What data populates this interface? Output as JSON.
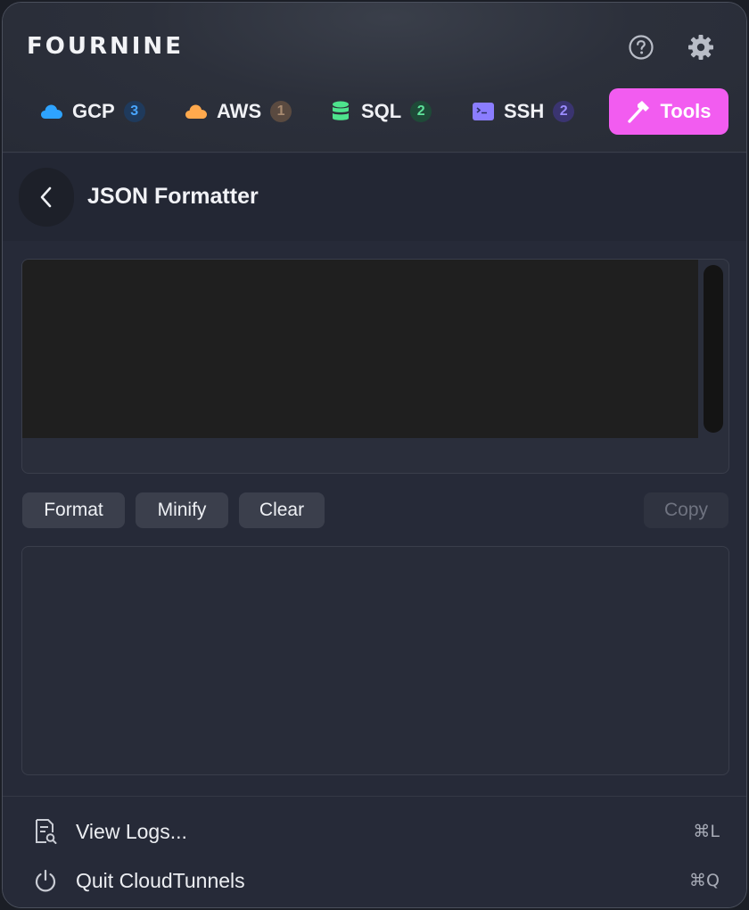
{
  "header": {
    "brand": "FOURNINE",
    "icons": {
      "help": "help-circle-icon",
      "settings": "gear-icon"
    }
  },
  "tabs": [
    {
      "label": "GCP",
      "badge": "3",
      "icon": "cloud-icon",
      "color": "#2ea3ff"
    },
    {
      "label": "AWS",
      "badge": "1",
      "icon": "cloud-icon",
      "color": "#ffa94d"
    },
    {
      "label": "SQL",
      "badge": "2",
      "icon": "database-icon",
      "color": "#4ee38d"
    },
    {
      "label": "SSH",
      "badge": "2",
      "icon": "terminal-icon",
      "color": "#8b7dff"
    },
    {
      "label": "Tools",
      "icon": "hammer-icon",
      "active": true,
      "color": "#f25cf0"
    }
  ],
  "page": {
    "title": "JSON Formatter"
  },
  "editor": {
    "input_value": "",
    "output_value": "",
    "format_label": "Format",
    "minify_label": "Minify",
    "clear_label": "Clear",
    "copy_label": "Copy"
  },
  "footer": {
    "view_logs_label": "View Logs...",
    "view_logs_shortcut": "⌘L",
    "quit_label": "Quit CloudTunnels",
    "quit_shortcut": "⌘Q"
  }
}
